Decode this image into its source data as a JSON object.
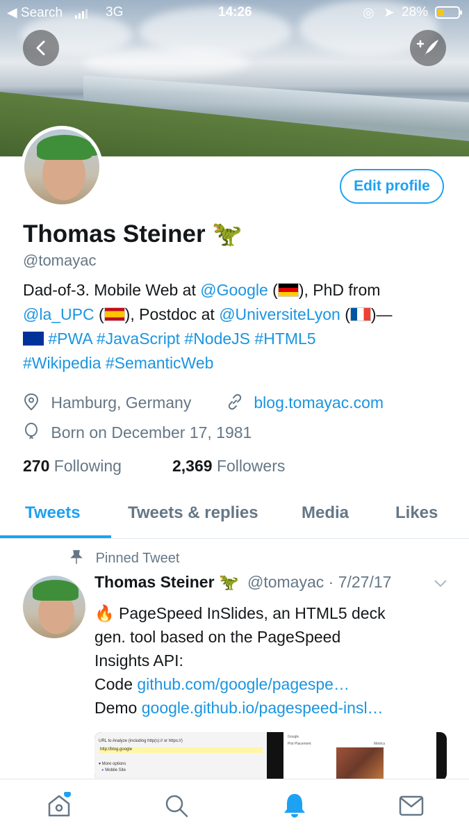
{
  "status_bar": {
    "back_app": "Search",
    "network": "3G",
    "time": "14:26",
    "battery": "28%"
  },
  "profile": {
    "name": "Thomas Steiner",
    "name_emoji": "🦖",
    "handle": "@tomayac",
    "edit_profile": "Edit profile",
    "bio": {
      "t1": "Dad-of-3. Mobile Web at ",
      "google": "@Google",
      "t2": " (",
      "t3": "), PhD from",
      "la_upc": "@la_UPC",
      "t4": " (",
      "t5": "), Postdoc at ",
      "univ_lyon": "@UniversiteLyon",
      "t6": " (",
      "t7": ")—",
      "hashtags": "#PWA #JavaScript #NodeJS #HTML5",
      "hashtags2": "#Wikipedia #SemanticWeb"
    },
    "location": "Hamburg, Germany",
    "website": "blog.tomayac.com",
    "birthday": "Born on December 17, 1981",
    "following_count": "270",
    "following_label": "Following",
    "followers_count": "2,369",
    "followers_label": "Followers"
  },
  "tabs": [
    "Tweets",
    "Tweets & replies",
    "Media",
    "Likes"
  ],
  "pinned_tweet": {
    "pinned_label": "Pinned Tweet",
    "author": "Thomas Steiner",
    "author_emoji": "🦖",
    "handle": "@tomayac",
    "date": "7/27/17",
    "line1": "PageSpeed InSlides, an HTML5 deck",
    "line1_emoji": "🔥",
    "line2": "gen. tool based on the PageSpeed",
    "line3": "Insights API:",
    "code_label": "Code ",
    "code_link": "github.com/google/pagespe…",
    "demo_label": "Demo ",
    "demo_link": "google.github.io/pagespeed-insl…",
    "thumb1_title": "URL to Analyze (including http(s):// or https://)",
    "thumb1_url": "http://blog.google",
    "thumb1_more": "▾ More options",
    "thumb1_opt": "Mobile Site",
    "thumb2_logo": "Google",
    "thumb2_item1": "Plot Placement",
    "thumb2_item2": "Metrics"
  },
  "colors": {
    "accent": "#1da1f2",
    "link": "#1b95e0",
    "muted": "#657786",
    "text": "#14171a"
  },
  "icons": [
    "back-icon",
    "compose-icon",
    "location-icon",
    "link-icon",
    "balloon-icon",
    "pin-icon",
    "chevron-down-icon",
    "home-icon",
    "search-icon",
    "notifications-icon",
    "messages-icon"
  ]
}
